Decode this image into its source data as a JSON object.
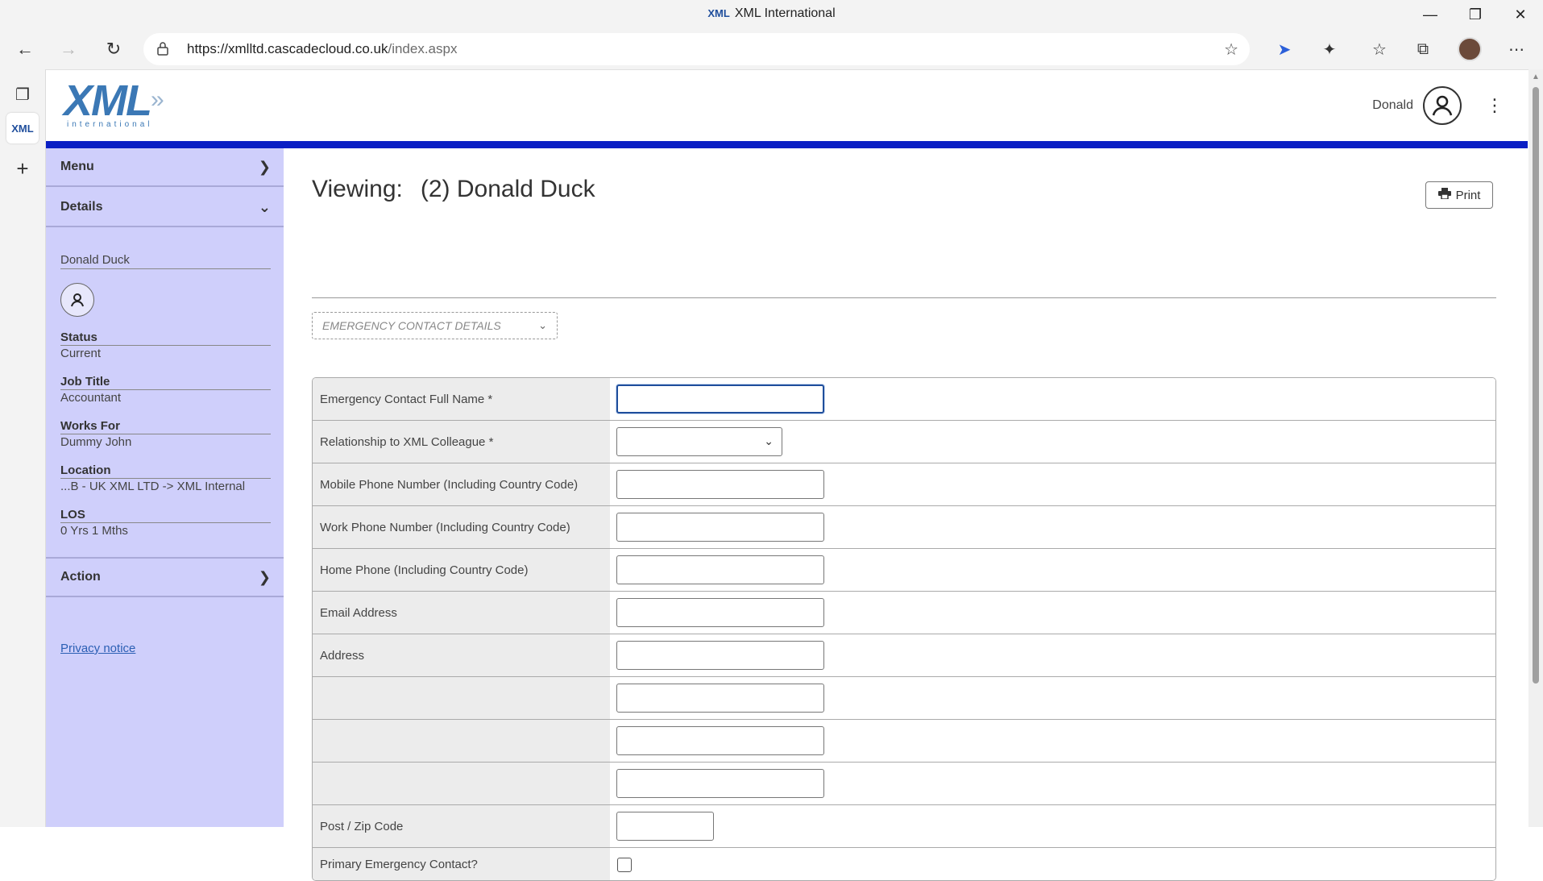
{
  "browser": {
    "window_title": "XML International",
    "tab_logo": "XML",
    "url_host": "https://xmlltd.cascadecloud.co.uk",
    "url_path": "/index.aspx"
  },
  "header": {
    "logo_text": "XML",
    "logo_sub": "international",
    "user_name": "Donald"
  },
  "sidebar": {
    "menu_label": "Menu",
    "details_label": "Details",
    "person_name": "Donald Duck",
    "fields": [
      {
        "label": "Status",
        "value": "Current"
      },
      {
        "label": "Job Title",
        "value": "Accountant"
      },
      {
        "label": "Works For",
        "value": "Dummy John"
      },
      {
        "label": "Location",
        "value": "...B - UK XML LTD -> XML Internal"
      },
      {
        "label": "LOS",
        "value": "0 Yrs 1 Mths"
      }
    ],
    "action_label": "Action",
    "privacy_link": "Privacy notice"
  },
  "main": {
    "viewing_label": "Viewing:",
    "viewing_name": "(2) Donald Duck",
    "print_label": "Print",
    "section_select": "Emergency Contact Details",
    "form": {
      "full_name_label": "Emergency Contact Full Name *",
      "relationship_label": "Relationship to XML Colleague *",
      "mobile_label": "Mobile Phone Number (Including Country Code)",
      "work_label": "Work Phone Number (Including Country Code)",
      "home_label": "Home Phone (Including Country Code)",
      "email_label": "Email Address",
      "address_label": "Address",
      "postcode_label": "Post / Zip Code",
      "primary_label": "Primary Emergency Contact?",
      "full_name_value": "",
      "relationship_value": "",
      "mobile_value": "",
      "work_value": "",
      "home_value": "",
      "email_value": "",
      "address_line1": "",
      "address_line2": "",
      "address_line3": "",
      "address_line4": "",
      "postcode_value": "",
      "primary_checked": false
    }
  }
}
